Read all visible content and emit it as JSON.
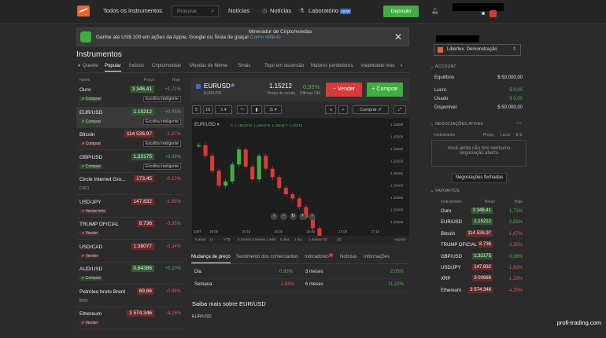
{
  "topbar": {
    "menu": "Todos os instrumentos",
    "search_placeholder": "Procurar",
    "news": "Notícias",
    "notices": "Notícias",
    "lab": "Laboratório",
    "lab_badge": "NEW",
    "deposit": "Depósito"
  },
  "promo": {
    "text": "Ganhe até US$ 200 em ações da Apple, Google ou Tesla de graça!",
    "link": "Como obtê-lo",
    "title": "Minerador de Criptomoedas"
  },
  "instruments_title": "Instrumentos",
  "tabs": [
    "Quente",
    "Popular",
    "Índices",
    "Criptomoedas",
    "Moedas de Meme",
    "Sinais",
    "Topo em ascensão",
    "Maiores perdedores",
    "Volatilidade máx"
  ],
  "list_header": {
    "name": "Nome",
    "price": "Preço",
    "today": "Hoje"
  },
  "instruments": [
    {
      "name": "Ouro",
      "price": "3 346,41",
      "chg": "+1,71%",
      "dir": "pos",
      "act": "Comprar",
      "esc": "Escolha inteligente"
    },
    {
      "name": "EUR/USD",
      "price": "1.15212",
      "chg": "+0,93%",
      "dir": "pos",
      "act": "Comprar",
      "esc": "Escolha inteligente"
    },
    {
      "name": "Bitcoin",
      "price": "114 526,97",
      "chg": "-1,67%",
      "dir": "neg",
      "act": "Comprar",
      "esc": "Escolha inteligente"
    },
    {
      "name": "GBP/USD",
      "price": "1,32175",
      "chg": "+0,08%",
      "dir": "pos",
      "act": "Comprar",
      "esc": "Escolha inteligente"
    },
    {
      "name": "Circle Internet Gro...",
      "price": "173,45",
      "chg": "-6,13%",
      "dir": "neg",
      "sub": "CRCL",
      "act": "",
      "esc": ""
    },
    {
      "name": "USD/JPY",
      "price": "147.832",
      "chg": "-1,93%",
      "dir": "neg",
      "act": "Venda forte",
      "esc": ""
    },
    {
      "name": "TRUMP OFICIAL",
      "price": "8.736",
      "chg": "-3,35%",
      "dir": "neg",
      "act": "Vender",
      "esc": ""
    },
    {
      "name": "USD/CAD",
      "price": "1.38077",
      "chg": "-0,34%",
      "dir": "neg",
      "act": "Vender",
      "esc": ""
    },
    {
      "name": "AUD/USD",
      "price": "0,64386",
      "chg": "+0,20%",
      "dir": "pos",
      "act": "Comprar",
      "esc": ""
    },
    {
      "name": "Petróleo bruto Brent",
      "price": "69,66",
      "chg": "-0,98%",
      "dir": "neg",
      "sub": "BRN",
      "act": "",
      "esc": ""
    },
    {
      "name": "Ethereum",
      "price": "3 574.346",
      "chg": "-4,25%",
      "dir": "neg",
      "act": "Vender",
      "esc": ""
    }
  ],
  "chart": {
    "symbol": "EURUSD",
    "sub": "EUR/USD",
    "sell_price": "1.15212",
    "sell_label": "Preço de venda",
    "change": "0,93%",
    "change_sub": "Últimas 24h",
    "sell_btn": "Vender",
    "buy_btn": "Comprar",
    "compare": "Comprar",
    "ohlc": "A: 1,15243 M: 1,15243 B: 1,15243 F: 1,15212",
    "times": [
      "16:00",
      "16:15",
      "16:30",
      "16:45",
      "17:00",
      "17:15"
    ],
    "yticks": [
      "1.15650",
      "1.15600",
      "1.15550",
      "1.15500",
      "1.15450",
      "1.15400",
      "1.15350",
      "1.15300",
      "1.15250"
    ],
    "periods": [
      "5 anos",
      "1A",
      "YTD",
      "6 meses",
      "3 meses",
      "1 mês",
      "5 dias",
      "1 dia",
      "1 minuto",
      "7D",
      "1D"
    ],
    "gmt": "GMT",
    "scale": "registro"
  },
  "chart_data": {
    "type": "line",
    "series": [
      {
        "values": [
          1.1557,
          1.1552,
          1.1545,
          1.1538,
          1.154,
          1.1548,
          1.1555,
          1.1547,
          1.1541,
          1.1552,
          1.1546,
          1.1542,
          1.1537,
          1.1534,
          1.1532,
          1.1528,
          1.1523,
          1.1518,
          1.1512,
          1.1509,
          1.1507,
          1.1505,
          1.1502,
          1.1503,
          1.1495,
          1.1487,
          1.1479
        ]
      }
    ]
  },
  "bottom_tabs": [
    "Mudança de preço",
    "Sentimento dos comerciantes",
    "Indicadores",
    "Notícias",
    "Informações"
  ],
  "stats": [
    {
      "a": "Dia",
      "av": "0,93%",
      "b": "3 meses",
      "bv": "2,05%"
    },
    {
      "a": "Semana",
      "av": "-1,88%",
      "b": "6 meses",
      "bv": "11,22%"
    }
  ],
  "learn": "Saiba mais sobre EUR/USD",
  "learn_sub": "EUR/USD",
  "account": {
    "name": "Libertex: Demonstração",
    "section": "ACCOUNT",
    "equity_label": "Equilíbrio",
    "equity": "$ 50.000,00",
    "profit_label": "Lucro",
    "profit": "$ 0,00",
    "used_label": "Usado",
    "used": "$ 0,00",
    "avail_label": "Disponível",
    "avail": "$ 50.000,00"
  },
  "open_trades": {
    "section": "NEGOCIAÇÕES ATIVAS",
    "col1": "Instrumento",
    "col2": "Preço",
    "col3": "Lucro",
    "empty": "Você ainda não tem nenhuma negociação aberta",
    "closed": "Negociações fechadas"
  },
  "favorites": {
    "section": "FAVORITOS",
    "h1": "Instrumento",
    "h2": "Preço",
    "h3": "Hoje",
    "items": [
      {
        "n": "Ouro",
        "p": "3 346,41",
        "c": "1,71%",
        "d": "pos"
      },
      {
        "n": "EUR/USD",
        "p": "1.15212",
        "c": "0,93%",
        "d": "pos"
      },
      {
        "n": "Bitcoin",
        "p": "114 526,97",
        "c": "-1,67%",
        "d": "neg"
      },
      {
        "n": "TRUMP OFICIAL",
        "p": "8.736",
        "c": "-3,35%",
        "d": "neg"
      },
      {
        "n": "GBP/USD",
        "p": "1,32175",
        "c": "0,08%",
        "d": "pos"
      },
      {
        "n": "USD/JPY",
        "p": "147.832",
        "c": "-1,93%",
        "d": "neg"
      },
      {
        "n": "XRP",
        "p": "3.00666",
        "c": "-1,33%",
        "d": "neg"
      },
      {
        "n": "Ethereum",
        "p": "3 574.346",
        "c": "-4,25%",
        "d": "neg"
      }
    ]
  },
  "watermark": "profi-trading.com"
}
